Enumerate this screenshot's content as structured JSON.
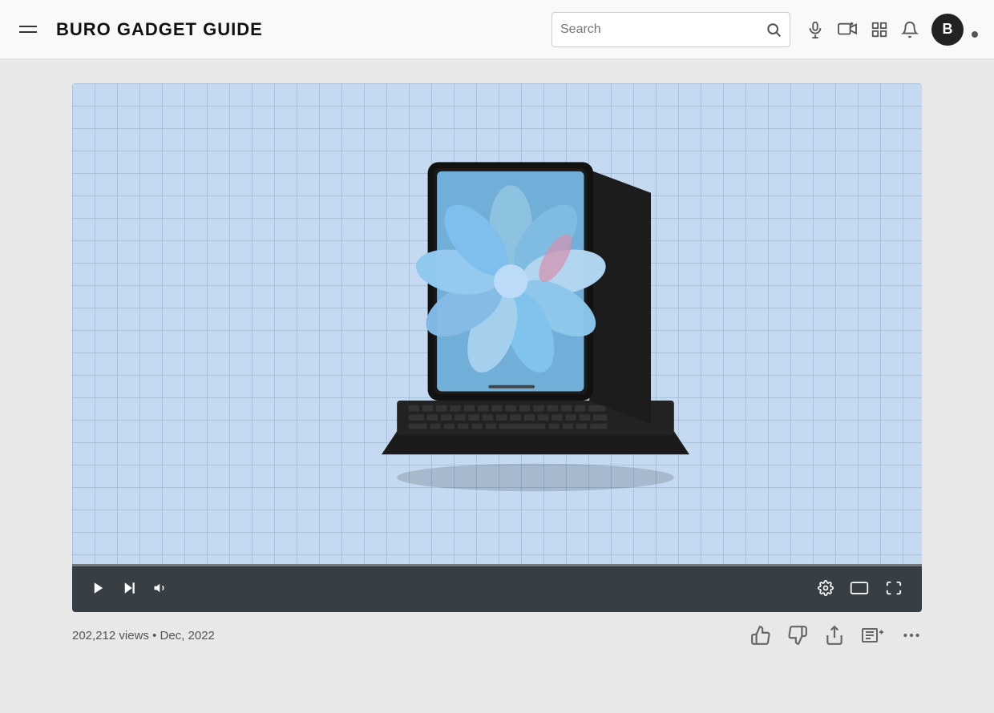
{
  "header": {
    "title": "BURO GADGET GUIDE",
    "search_placeholder": "Search",
    "avatar_letter": "B"
  },
  "video": {
    "views": "202,212 views",
    "date": "Dec, 2022",
    "progress_percent": 0
  },
  "controls": {
    "play": "▶",
    "next": "⏭",
    "volume": "🔊",
    "settings": "⚙",
    "theater": "⬜",
    "fullscreen": "⛶"
  },
  "actions": {
    "like": "👍",
    "dislike": "👎",
    "share": "↪",
    "save": "≡+",
    "more": "···"
  }
}
